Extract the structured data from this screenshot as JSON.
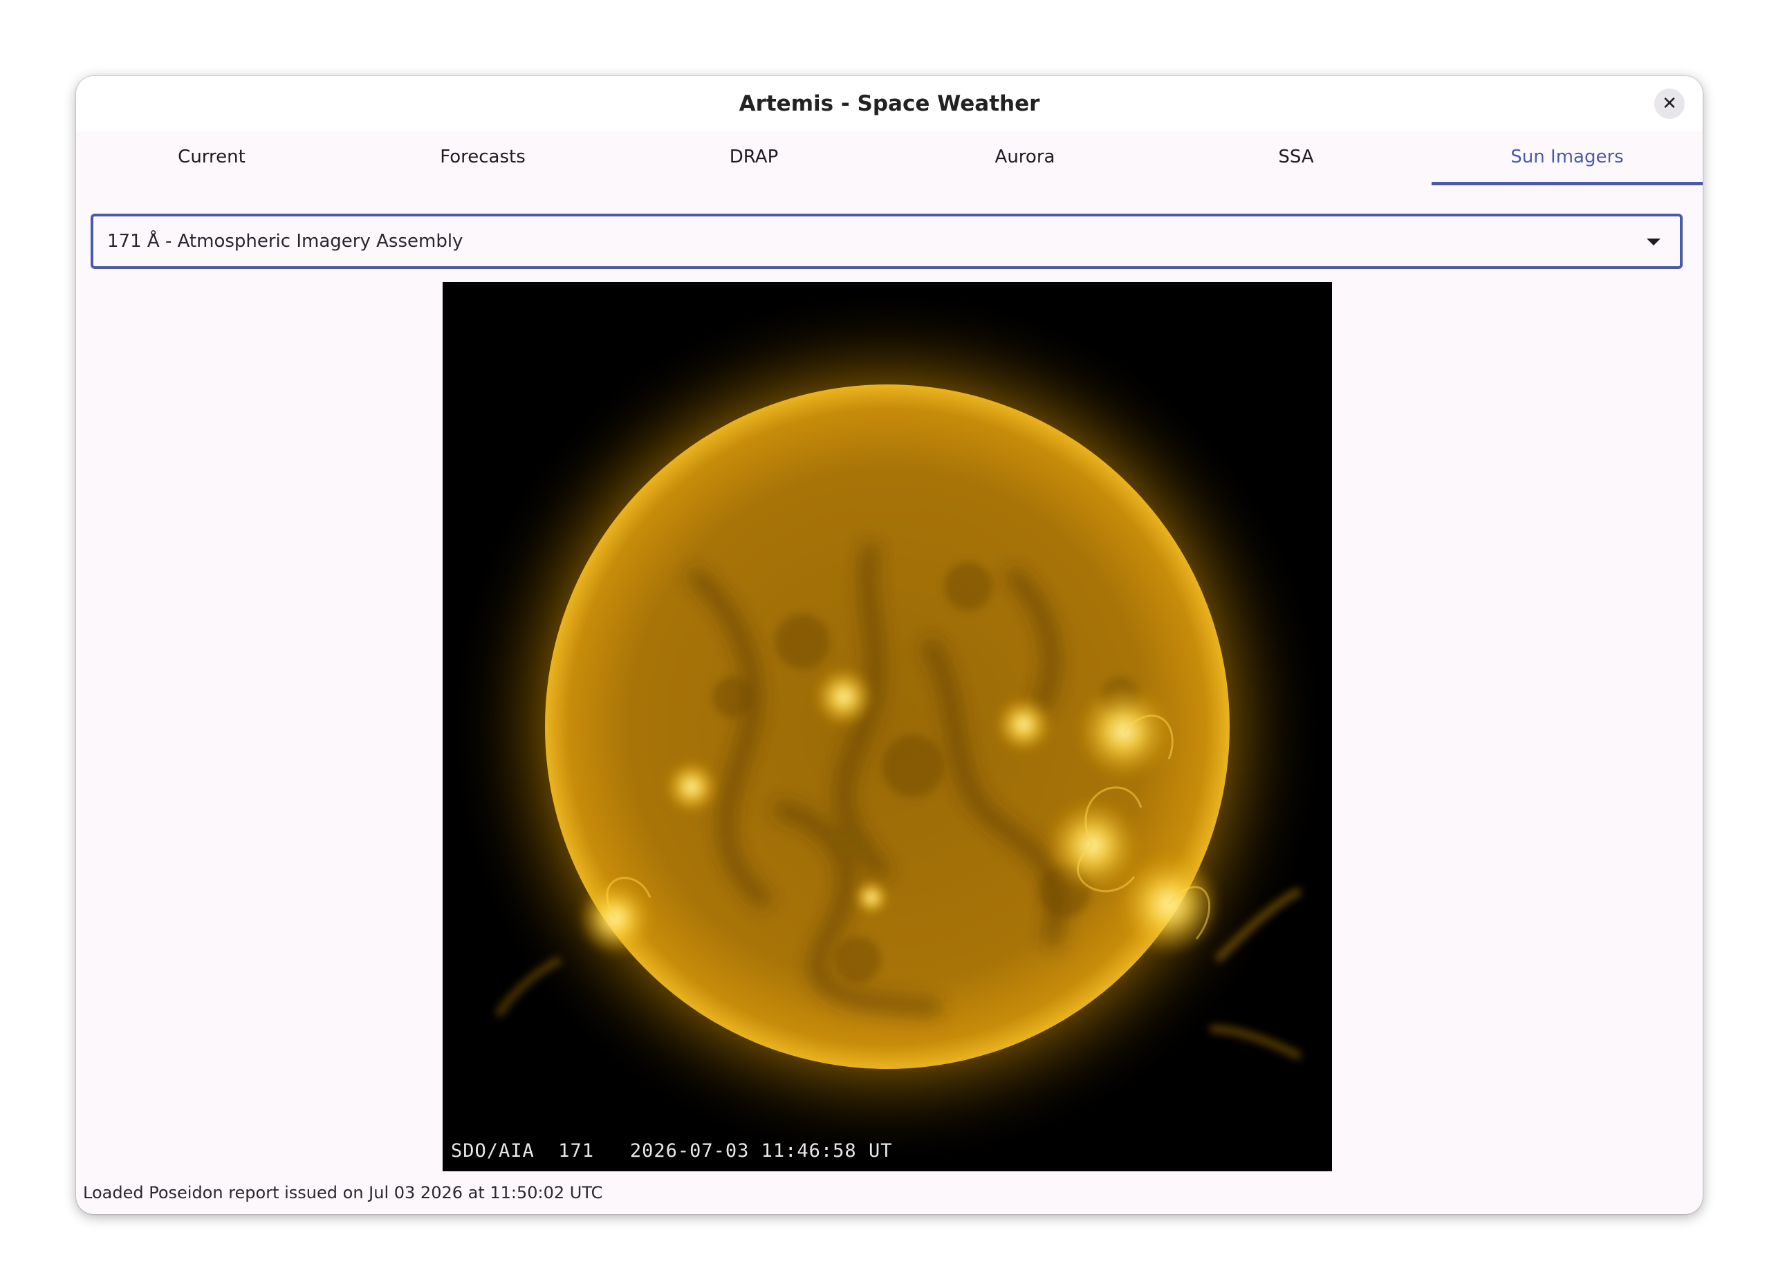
{
  "window": {
    "title": "Artemis - Space Weather",
    "close_symbol": "✕"
  },
  "tabs": [
    {
      "label": "Current",
      "active": false
    },
    {
      "label": "Forecasts",
      "active": false
    },
    {
      "label": "DRAP",
      "active": false
    },
    {
      "label": "Aurora",
      "active": false
    },
    {
      "label": "SSA",
      "active": false
    },
    {
      "label": "Sun Imagers",
      "active": true
    }
  ],
  "imager_select": {
    "selected": "171 Å - Atmospheric Imagery Assembly"
  },
  "sun_image": {
    "caption": "SDO/AIA  171   2026-07-03 11:46:58 UT",
    "colors": {
      "corona": "#d99a00",
      "disk": "#a87408",
      "bright": "#ffd84a"
    }
  },
  "status": {
    "text": "Loaded Poseidon report issued on Jul 03 2026 at 11:50:02 UTC"
  },
  "theme": {
    "accent": "#4a5aa8"
  }
}
